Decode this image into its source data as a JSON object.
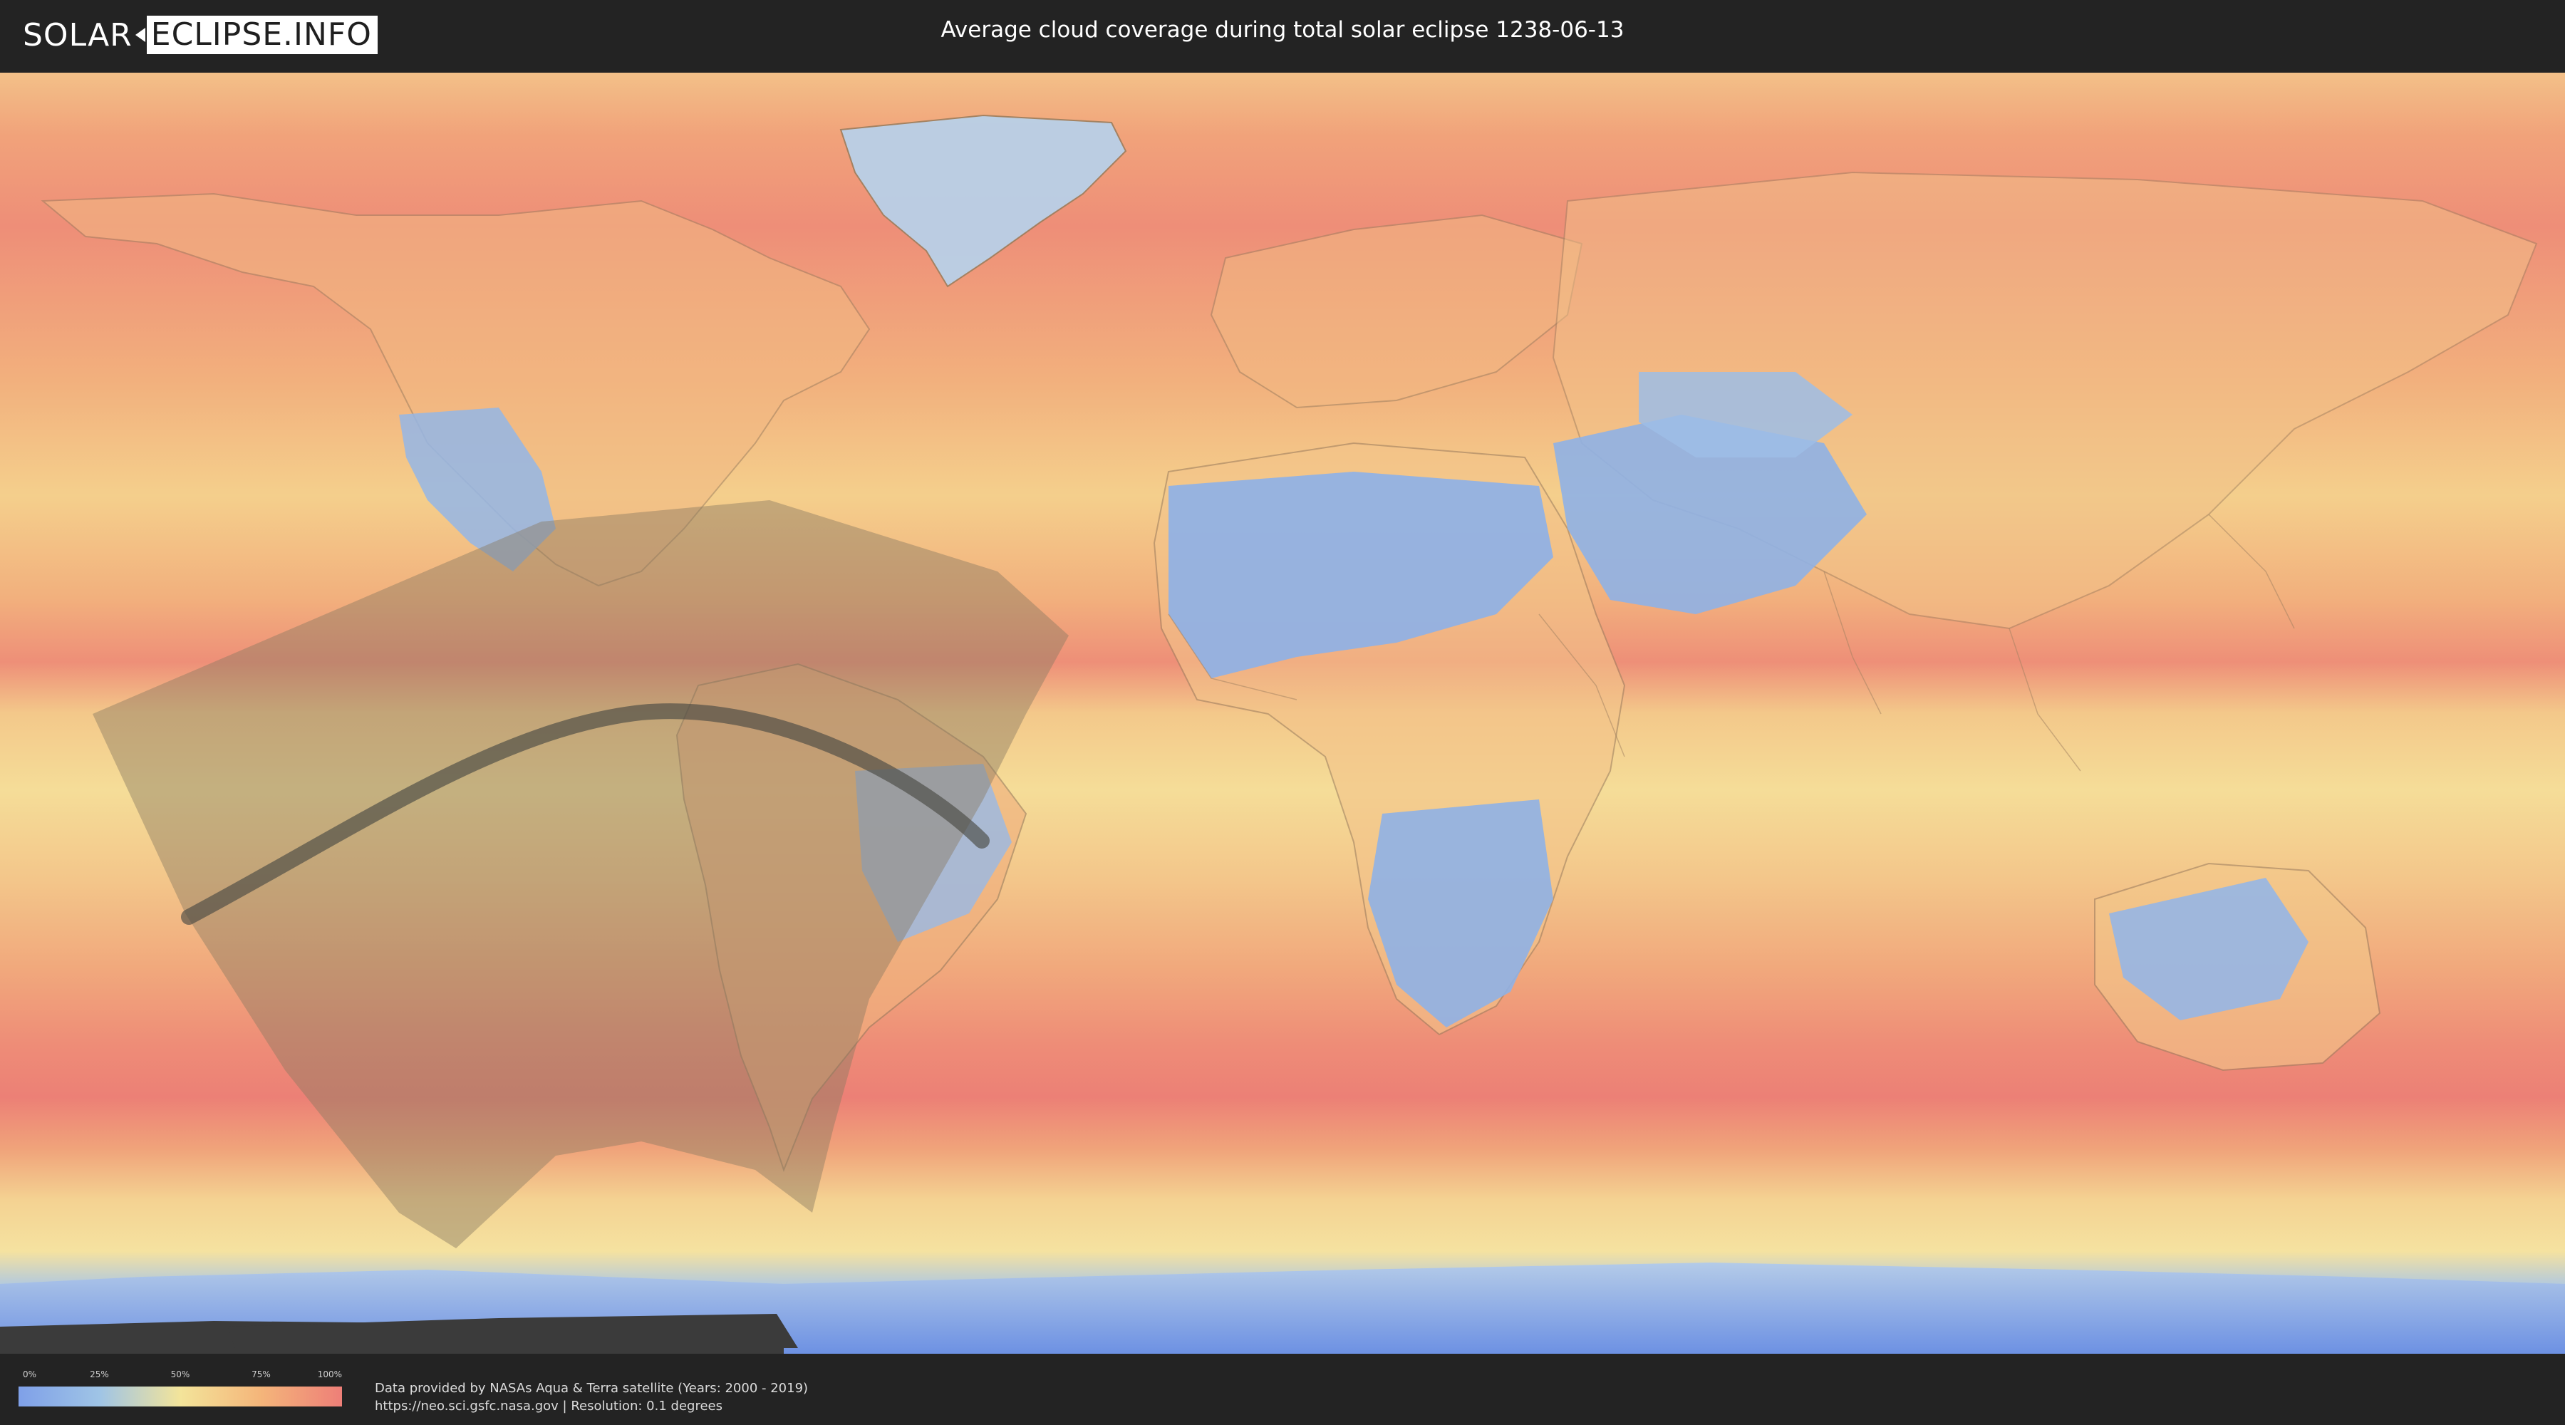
{
  "header": {
    "logo_left": "SOLAR",
    "logo_right": "ECLIPSE.INFO",
    "title": "Average cloud coverage during total solar eclipse 1238-06-13"
  },
  "legend": {
    "ticks": [
      "0%",
      "25%",
      "50%",
      "75%",
      "100%"
    ],
    "colors": [
      "#7fa0e8",
      "#9fc4e6",
      "#f3e49a",
      "#f4b57a",
      "#ee7f78"
    ]
  },
  "footer": {
    "credit_line1": "Data provided by NASAs Aqua & Terra satellite (Years: 2000 - 2019)",
    "credit_line2": "https://neo.sci.gsfc.nasa.gov | Resolution: 0.1 degrees"
  },
  "map": {
    "projection": "equirectangular",
    "colors": {
      "high_cloud": "#ee7f78",
      "mid_cloud": "#f4b57a",
      "low_cloud": "#f3e49a",
      "clear": "#8fb0e6",
      "antarctic_gap": "#3a3a3a",
      "eclipse_region": "#8a7a62",
      "totality_path": "#4a4a44"
    }
  }
}
